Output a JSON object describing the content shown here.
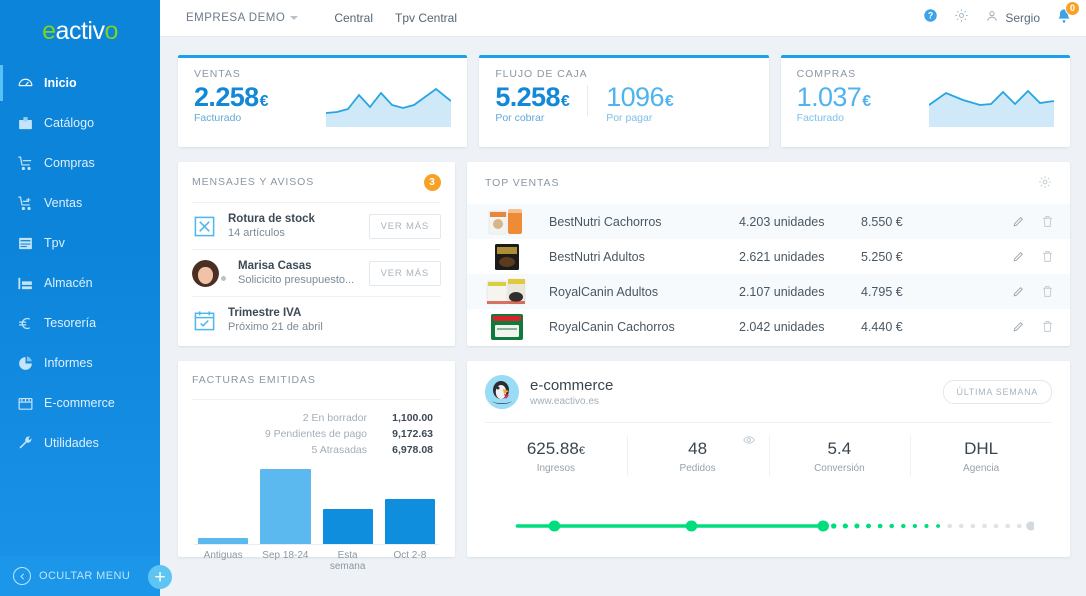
{
  "brand": {
    "logo_part1": "e",
    "logo_part2": "activ",
    "logo_part3": "o"
  },
  "sidebar": {
    "items": [
      {
        "label": "Inicio",
        "icon": "home-icon",
        "active": true
      },
      {
        "label": "Catálogo",
        "icon": "box-icon",
        "active": false
      },
      {
        "label": "Compras",
        "icon": "cart-icon",
        "active": false
      },
      {
        "label": "Ventas",
        "icon": "cart-plus-icon",
        "active": false
      },
      {
        "label": "Tpv",
        "icon": "receipt-icon",
        "active": false
      },
      {
        "label": "Almacén",
        "icon": "warehouse-icon",
        "active": false
      },
      {
        "label": "Tesorería",
        "icon": "euro-icon",
        "active": false
      },
      {
        "label": "Informes",
        "icon": "pie-chart-icon",
        "active": false
      },
      {
        "label": "E-commerce",
        "icon": "store-icon",
        "active": false
      },
      {
        "label": "Utilidades",
        "icon": "wrench-icon",
        "active": false
      }
    ],
    "hide_menu_label": "OCULTAR MENU",
    "add_button_label": "+"
  },
  "topbar": {
    "company": "EMPRESA DEMO",
    "links": [
      "Central",
      "Tpv Central"
    ],
    "help_icon": "help-icon",
    "settings_icon": "gear-icon",
    "user_icon": "user-icon",
    "username": "Sergio",
    "bell_icon": "bell-icon",
    "notification_count": "0"
  },
  "kpis": [
    {
      "label": "VENTAS",
      "values": [
        {
          "amount": "2.258",
          "currency": "€",
          "caption": "Facturado",
          "style": "primary"
        }
      ],
      "has_sparkline": true,
      "sparkline": [
        28,
        27,
        24,
        12,
        22,
        10,
        20,
        23,
        20,
        14,
        6,
        16
      ]
    },
    {
      "label": "FLUJO DE CAJA",
      "values": [
        {
          "amount": "5.258",
          "currency": "€",
          "caption": "Por cobrar",
          "style": "primary"
        },
        {
          "amount": "1096",
          "currency": "€",
          "caption": "Por pagar",
          "style": "light"
        }
      ],
      "has_sparkline": false
    },
    {
      "label": "COMPRAS",
      "values": [
        {
          "amount": "1.037",
          "currency": "€",
          "caption": "Facturado",
          "style": "primary"
        }
      ],
      "has_sparkline": true,
      "sparkline": [
        22,
        8,
        12,
        17,
        20,
        21,
        10,
        20,
        8,
        20,
        18,
        17
      ]
    }
  ],
  "messages": {
    "title": "MENSAJES Y AVISOS",
    "count": "3",
    "items": [
      {
        "icon": "x-box-icon",
        "title": "Rotura de stock",
        "subtitle": "14 artículos",
        "action": "VER MÁS",
        "has_action": true
      },
      {
        "icon": "avatar",
        "title": "Marisa Casas",
        "subtitle": "Solicicito presupuesto...",
        "action": "VER MÁS",
        "has_action": true
      },
      {
        "icon": "calendar-icon",
        "title": "Trimestre IVA",
        "subtitle": "Próximo 21 de abril",
        "action": "",
        "has_action": false
      }
    ]
  },
  "top_ventas": {
    "title": "TOP VENTAS",
    "gear_icon": "gear-icon",
    "rows": [
      {
        "thumb": "bestnutri-cachorros-bag",
        "name": "BestNutri Cachorros",
        "units": "4.203 unidades",
        "amount": "8.550 €"
      },
      {
        "thumb": "bestnutri-adultos-bag",
        "name": "BestNutri Adultos",
        "units": "2.621 unidades",
        "amount": "5.250 €"
      },
      {
        "thumb": "royalcanin-adultos-bag",
        "name": "RoyalCanin Adultos",
        "units": "2.107 unidades",
        "amount": "4.795 €"
      },
      {
        "thumb": "royalcanin-cachorros-bag",
        "name": "RoyalCanin Cachorros",
        "units": "2.042 unidades",
        "amount": "4.440 €"
      }
    ],
    "edit_icon": "pencil-icon",
    "delete_icon": "trash-icon"
  },
  "facturas": {
    "title": "FACTURAS EMITIDAS",
    "stats": [
      {
        "label": "2 En borrador",
        "value": "1,100.00"
      },
      {
        "label": "9 Pendientes de pago",
        "value": "9,172.63"
      },
      {
        "label": "5 Atrasadas",
        "value": "6,978.08"
      }
    ]
  },
  "ecommerce": {
    "logo_icon": "prestashop-icon",
    "title": "e-commerce",
    "url": "www.eactivo.es",
    "period_button": "ÚLTIMA SEMANA",
    "eye_icon": "eye-icon",
    "stats": [
      {
        "value": "625.88",
        "currency": "€",
        "label": "Ingresos"
      },
      {
        "value": "48",
        "currency": "",
        "label": "Pedidos"
      },
      {
        "value": "5.4",
        "currency": "",
        "label": "Conversión"
      },
      {
        "value": "DHL",
        "currency": "",
        "label": "Agencia"
      }
    ],
    "progress_color": "#00dd7d",
    "progress_pct": 60
  },
  "chart_data": {
    "type": "bar",
    "title": "FACTURAS EMITIDAS",
    "categories": [
      "Antiguas",
      "Sep 18-24",
      "Esta semana",
      "Oct 2-8"
    ],
    "values": [
      5,
      58,
      27,
      35
    ],
    "colors": [
      "#5bb9f0",
      "#5bb9f0",
      "#108ede",
      "#108ede"
    ],
    "ylim": [
      0,
      62
    ],
    "grid": false,
    "xlabel": "",
    "ylabel": "",
    "legend": "none",
    "annotations": [
      {
        "label": "2 En borrador",
        "value": 1100.0
      },
      {
        "label": "9 Pendientes de pago",
        "value": 9172.63
      },
      {
        "label": "5 Atrasadas",
        "value": 6978.08
      }
    ]
  }
}
